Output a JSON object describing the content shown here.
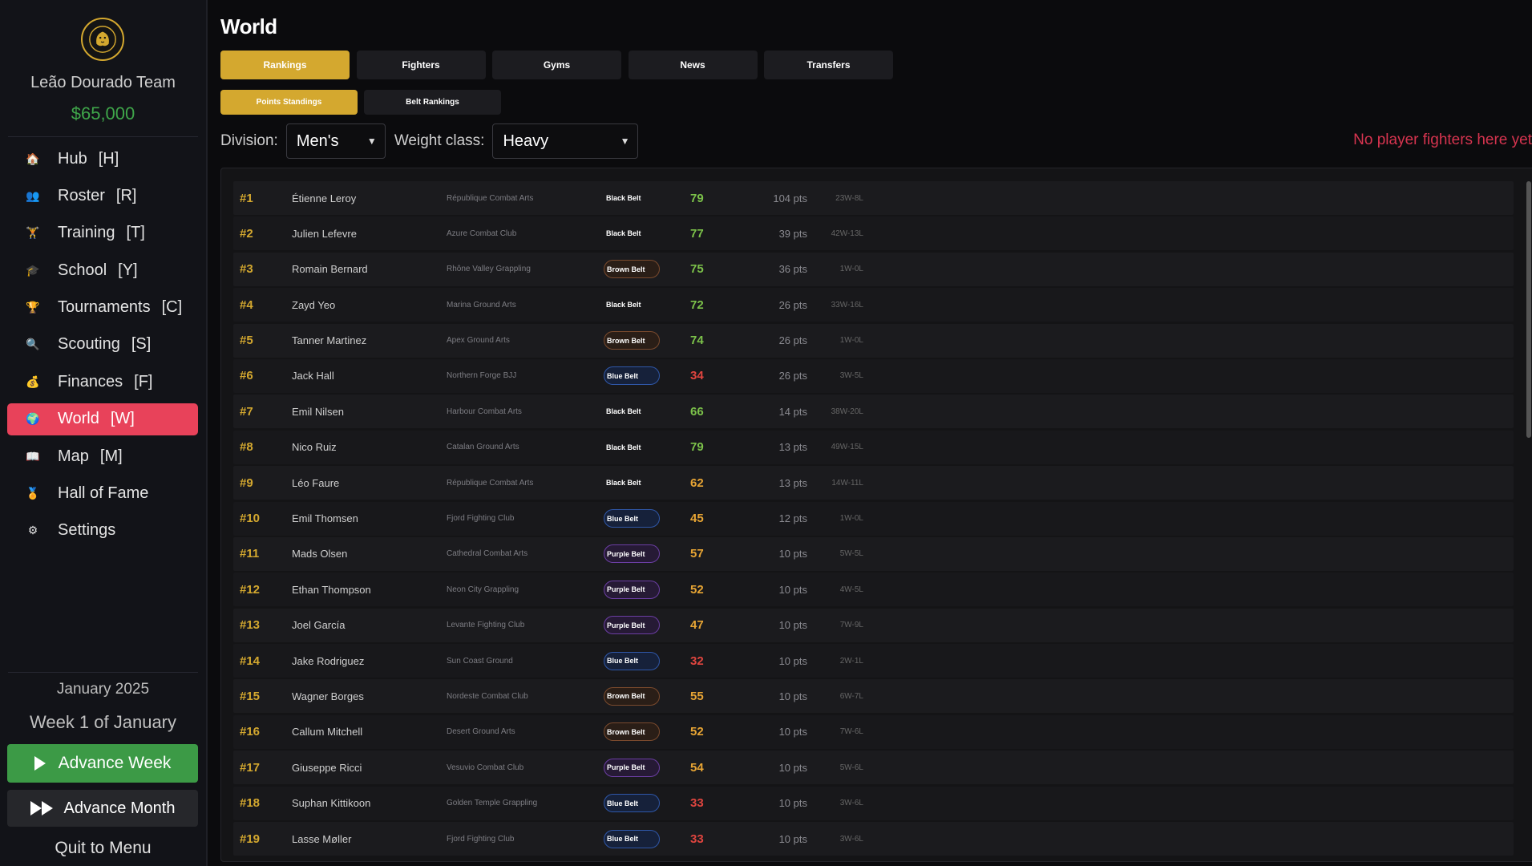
{
  "sidebar": {
    "team_name": "Leão Dourado Team",
    "money": "$65,000",
    "items": [
      {
        "label": "Hub",
        "key": "[H]",
        "icon": "house-icon",
        "glyph": "🏠",
        "active": false
      },
      {
        "label": "Roster",
        "key": "[R]",
        "icon": "people-icon",
        "glyph": "👥",
        "active": false
      },
      {
        "label": "Training",
        "key": "[T]",
        "icon": "dumbbell-icon",
        "glyph": "🏋",
        "active": false
      },
      {
        "label": "School",
        "key": "[Y]",
        "icon": "graduation-cap-icon",
        "glyph": "🎓",
        "active": false
      },
      {
        "label": "Tournaments",
        "key": "[C]",
        "icon": "trophy-icon",
        "glyph": "🏆",
        "active": false
      },
      {
        "label": "Scouting",
        "key": "[S]",
        "icon": "magnifier-icon",
        "glyph": "🔍",
        "active": false
      },
      {
        "label": "Finances",
        "key": "[F]",
        "icon": "money-bag-icon",
        "glyph": "💰",
        "active": false
      },
      {
        "label": "World",
        "key": "[W]",
        "icon": "globe-icon",
        "glyph": "🌍",
        "active": true
      },
      {
        "label": "Map",
        "key": "[M]",
        "icon": "map-icon",
        "glyph": "📖",
        "active": false
      },
      {
        "label": "Hall of Fame",
        "key": "",
        "icon": "medal-icon",
        "glyph": "🏅",
        "active": false
      },
      {
        "label": "Settings",
        "key": "",
        "icon": "gear-icon",
        "glyph": "⚙",
        "active": false
      }
    ],
    "date": "January 2025",
    "week": "Week 1 of January",
    "advance_week": "Advance Week",
    "advance_month": "Advance Month",
    "quit": "Quit to Menu"
  },
  "main": {
    "title": "World",
    "tabs": [
      {
        "label": "Rankings",
        "active": true
      },
      {
        "label": "Fighters",
        "active": false
      },
      {
        "label": "Gyms",
        "active": false
      },
      {
        "label": "News",
        "active": false
      },
      {
        "label": "Transfers",
        "active": false
      }
    ],
    "subtabs": [
      {
        "label": "Points Standings",
        "active": true
      },
      {
        "label": "Belt Rankings",
        "active": false
      }
    ],
    "division_label": "Division:",
    "division_value": "Men's",
    "weight_label": "Weight class:",
    "weight_value": "Heavy",
    "no_player": "No player fighters here yet"
  },
  "colors": {
    "gold": "#d4a82f",
    "active_nav": "#e8425a",
    "ovr_green": "#7cc24a",
    "ovr_orange": "#e8a534",
    "ovr_red": "#e0453f"
  },
  "rankings": [
    {
      "rank": "#1",
      "name": "Étienne Leroy",
      "gym": "République Combat Arts",
      "belt": "Black Belt",
      "belt_class": "black",
      "ovr": "79",
      "ovr_color": "#7cc24a",
      "pts": "104 pts",
      "record": "23W-8L"
    },
    {
      "rank": "#2",
      "name": "Julien Lefevre",
      "gym": "Azure Combat Club",
      "belt": "Black Belt",
      "belt_class": "black",
      "ovr": "77",
      "ovr_color": "#7cc24a",
      "pts": "39 pts",
      "record": "42W-13L"
    },
    {
      "rank": "#3",
      "name": "Romain Bernard",
      "gym": "Rhône Valley Grappling",
      "belt": "Brown Belt",
      "belt_class": "brown",
      "ovr": "75",
      "ovr_color": "#7cc24a",
      "pts": "36 pts",
      "record": "1W-0L"
    },
    {
      "rank": "#4",
      "name": "Zayd Yeo",
      "gym": "Marina Ground Arts",
      "belt": "Black Belt",
      "belt_class": "black",
      "ovr": "72",
      "ovr_color": "#7cc24a",
      "pts": "26 pts",
      "record": "33W-16L"
    },
    {
      "rank": "#5",
      "name": "Tanner Martinez",
      "gym": "Apex Ground Arts",
      "belt": "Brown Belt",
      "belt_class": "brown",
      "ovr": "74",
      "ovr_color": "#7cc24a",
      "pts": "26 pts",
      "record": "1W-0L"
    },
    {
      "rank": "#6",
      "name": "Jack Hall",
      "gym": "Northern Forge BJJ",
      "belt": "Blue Belt",
      "belt_class": "blue",
      "ovr": "34",
      "ovr_color": "#e0453f",
      "pts": "26 pts",
      "record": "3W-5L"
    },
    {
      "rank": "#7",
      "name": "Emil Nilsen",
      "gym": "Harbour Combat Arts",
      "belt": "Black Belt",
      "belt_class": "black",
      "ovr": "66",
      "ovr_color": "#7cc24a",
      "pts": "14 pts",
      "record": "38W-20L"
    },
    {
      "rank": "#8",
      "name": "Nico Ruiz",
      "gym": "Catalan Ground Arts",
      "belt": "Black Belt",
      "belt_class": "black",
      "ovr": "79",
      "ovr_color": "#7cc24a",
      "pts": "13 pts",
      "record": "49W-15L"
    },
    {
      "rank": "#9",
      "name": "Léo Faure",
      "gym": "République Combat Arts",
      "belt": "Black Belt",
      "belt_class": "black",
      "ovr": "62",
      "ovr_color": "#e8a534",
      "pts": "13 pts",
      "record": "14W-11L"
    },
    {
      "rank": "#10",
      "name": "Emil Thomsen",
      "gym": "Fjord Fighting Club",
      "belt": "Blue Belt",
      "belt_class": "blue",
      "ovr": "45",
      "ovr_color": "#e8a534",
      "pts": "12 pts",
      "record": "1W-0L"
    },
    {
      "rank": "#11",
      "name": "Mads Olsen",
      "gym": "Cathedral Combat Arts",
      "belt": "Purple Belt",
      "belt_class": "purple",
      "ovr": "57",
      "ovr_color": "#e8a534",
      "pts": "10 pts",
      "record": "5W-5L"
    },
    {
      "rank": "#12",
      "name": "Ethan Thompson",
      "gym": "Neon City Grappling",
      "belt": "Purple Belt",
      "belt_class": "purple",
      "ovr": "52",
      "ovr_color": "#e8a534",
      "pts": "10 pts",
      "record": "4W-5L"
    },
    {
      "rank": "#13",
      "name": "Joel García",
      "gym": "Levante Fighting Club",
      "belt": "Purple Belt",
      "belt_class": "purple",
      "ovr": "47",
      "ovr_color": "#e8a534",
      "pts": "10 pts",
      "record": "7W-9L"
    },
    {
      "rank": "#14",
      "name": "Jake Rodriguez",
      "gym": "Sun Coast Ground",
      "belt": "Blue Belt",
      "belt_class": "blue",
      "ovr": "32",
      "ovr_color": "#e0453f",
      "pts": "10 pts",
      "record": "2W-1L"
    },
    {
      "rank": "#15",
      "name": "Wagner Borges",
      "gym": "Nordeste Combat Club",
      "belt": "Brown Belt",
      "belt_class": "brown",
      "ovr": "55",
      "ovr_color": "#e8a534",
      "pts": "10 pts",
      "record": "6W-7L"
    },
    {
      "rank": "#16",
      "name": "Callum Mitchell",
      "gym": "Desert Ground Arts",
      "belt": "Brown Belt",
      "belt_class": "brown",
      "ovr": "52",
      "ovr_color": "#e8a534",
      "pts": "10 pts",
      "record": "7W-6L"
    },
    {
      "rank": "#17",
      "name": "Giuseppe Ricci",
      "gym": "Vesuvio Combat Club",
      "belt": "Purple Belt",
      "belt_class": "purple",
      "ovr": "54",
      "ovr_color": "#e8a534",
      "pts": "10 pts",
      "record": "5W-6L"
    },
    {
      "rank": "#18",
      "name": "Suphan Kittikoon",
      "gym": "Golden Temple Grappling",
      "belt": "Blue Belt",
      "belt_class": "blue",
      "ovr": "33",
      "ovr_color": "#e0453f",
      "pts": "10 pts",
      "record": "3W-6L"
    },
    {
      "rank": "#19",
      "name": "Lasse Møller",
      "gym": "Fjord Fighting Club",
      "belt": "Blue Belt",
      "belt_class": "blue",
      "ovr": "33",
      "ovr_color": "#e0453f",
      "pts": "10 pts",
      "record": "3W-6L"
    }
  ]
}
